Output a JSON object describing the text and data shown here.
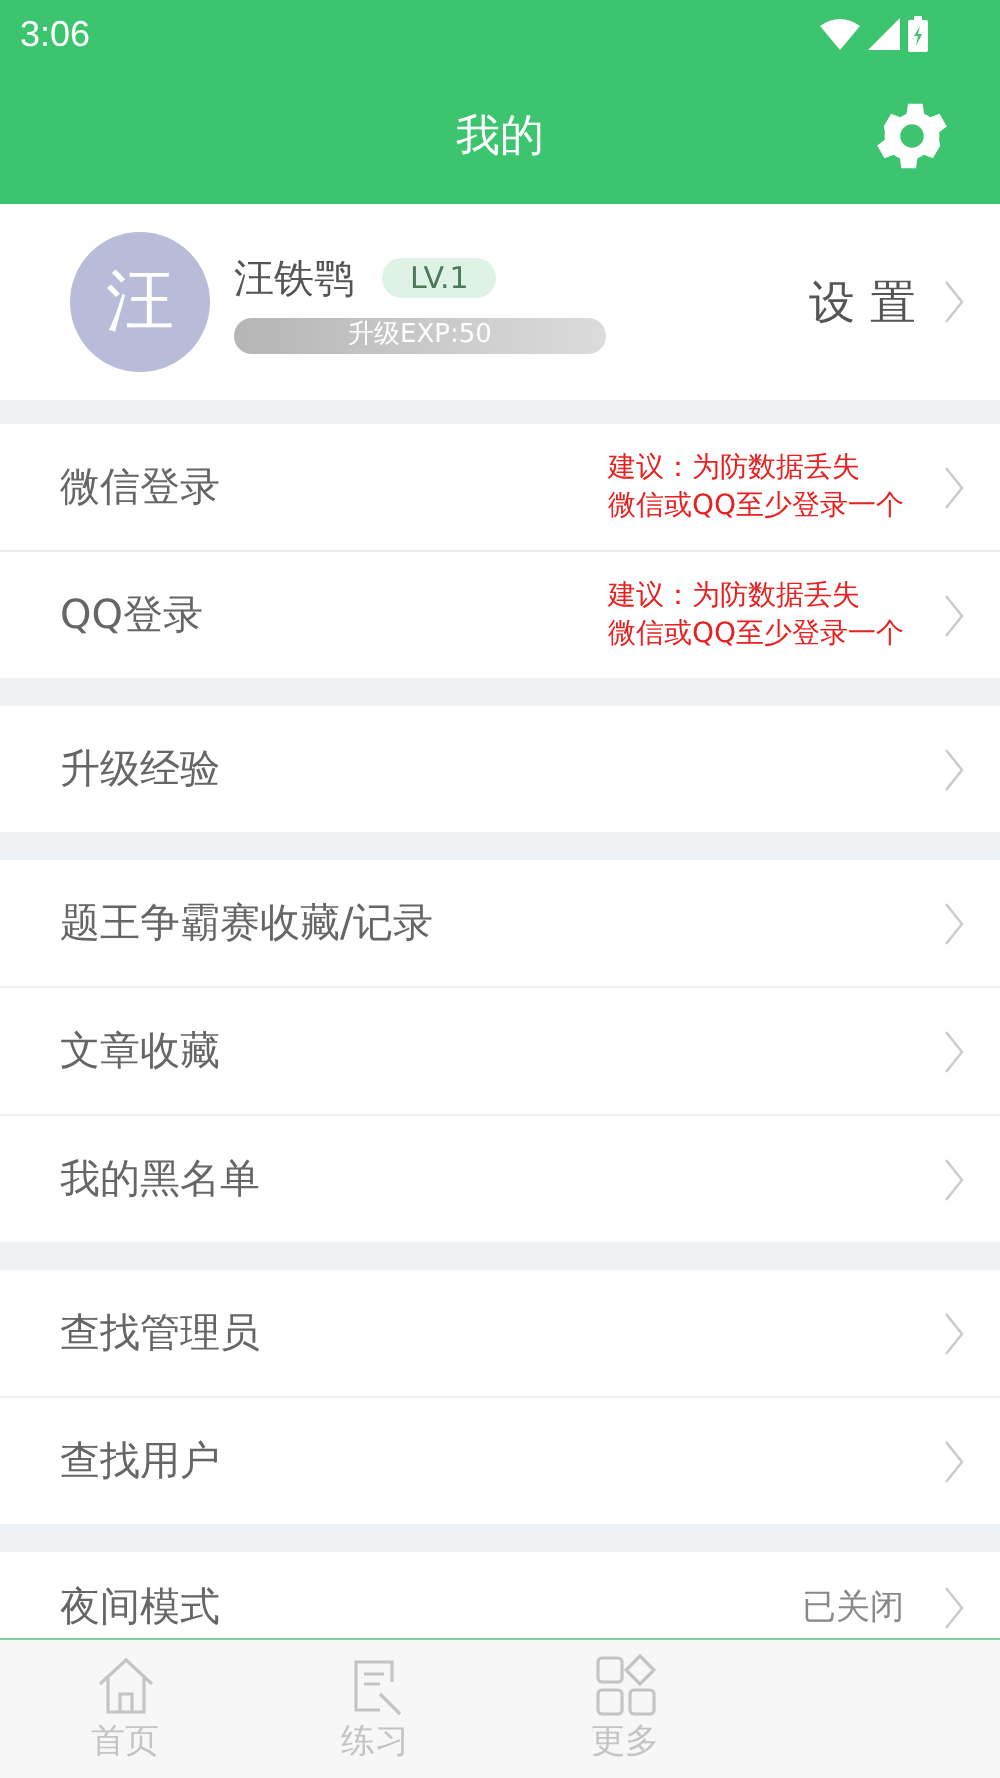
{
  "status_bar": {
    "time": "3:06"
  },
  "header": {
    "title": "我的"
  },
  "profile": {
    "avatar": "汪",
    "name": "汪铁鹗",
    "level_badge": "LV.1",
    "exp": "升级EXP:50",
    "settings": "设 置"
  },
  "groups": [
    {
      "items": [
        {
          "label": "微信登录",
          "note": [
            "建议：为防数据丢失",
            "微信或QQ至少登录一个"
          ]
        },
        {
          "label": "QQ登录",
          "note": [
            "建议：为防数据丢失",
            "微信或QQ至少登录一个"
          ]
        }
      ]
    },
    {
      "items": [
        {
          "label": "升级经验"
        }
      ]
    },
    {
      "items": [
        {
          "label": "题王争霸赛收藏/记录"
        },
        {
          "label": "文章收藏"
        },
        {
          "label": "我的黑名单"
        }
      ]
    },
    {
      "items": [
        {
          "label": "查找管理员"
        },
        {
          "label": "查找用户"
        }
      ]
    },
    {
      "items": [
        {
          "label": "夜间模式",
          "value": "已关闭"
        }
      ]
    }
  ],
  "bottom_nav": [
    {
      "label": "首页",
      "selected": false
    },
    {
      "label": "练习",
      "selected": false
    },
    {
      "label": "更多",
      "selected": false
    }
  ]
}
